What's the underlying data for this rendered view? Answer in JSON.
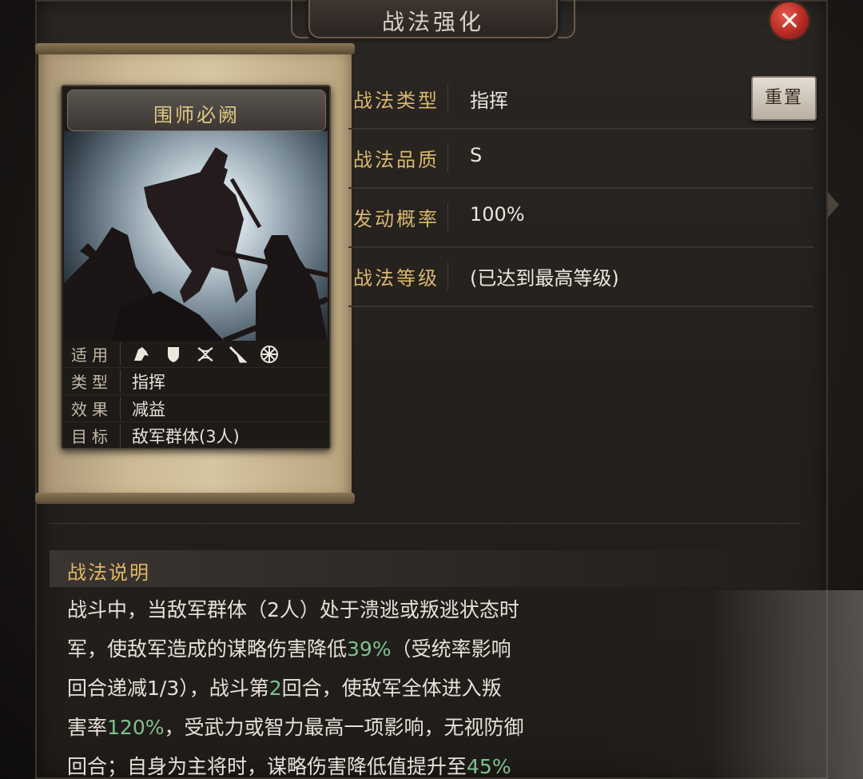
{
  "header": {
    "title": "战法强化"
  },
  "card": {
    "name": "围师必阙",
    "rows": {
      "applicable_label": "适用",
      "applicable_units": [
        "cavalry-icon",
        "shield-icon",
        "crossbow-icon",
        "spear-icon",
        "siege-icon"
      ],
      "type_label": "类型",
      "type_value": "指挥",
      "effect_label": "效果",
      "effect_value": "减益",
      "target_label": "目标",
      "target_value": "敌军群体(3人)"
    }
  },
  "attributes": [
    {
      "label": "战法类型",
      "value": "指挥"
    },
    {
      "label": "战法品质",
      "value": "S"
    },
    {
      "label": "发动概率",
      "value": "100%"
    },
    {
      "label": "战法等级",
      "value": "(已达到最高等级)"
    }
  ],
  "reset_label": "重置",
  "description": {
    "header": "战法说明",
    "lines": [
      {
        "a": "战斗中，当敌军群体（2人）处于溃逃或叛逃状态时",
        "b": "",
        "c": ""
      },
      {
        "a": "军，使敌军造成的谋略伤害降低",
        "b": "39%",
        "c": "（受统率影响"
      },
      {
        "a": "回合递减1/3），战斗第",
        "b": "2",
        "c": "回合，使敌军全体进入叛"
      },
      {
        "a": "害率",
        "b": "120%",
        "c": "，受武力或智力最高一项影响，无视防御"
      },
      {
        "a": "回合；自身为主将时，谋略伤害降低值提升至",
        "b": "45%",
        "c": ""
      }
    ]
  }
}
